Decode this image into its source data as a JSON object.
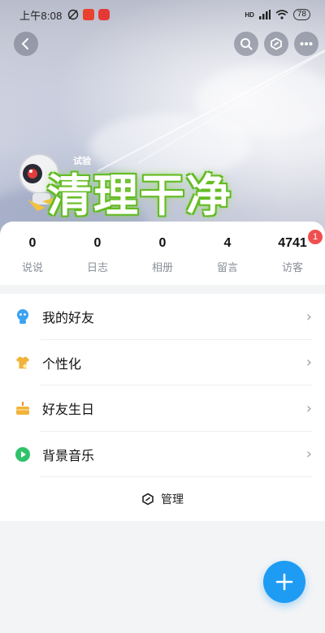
{
  "statusbar": {
    "time": "上午8:08",
    "network": "HD",
    "battery": "78"
  },
  "cover": {
    "overlay_text": "清理干净",
    "small_label": "试验"
  },
  "top_actions": [
    "back-icon",
    "search-icon",
    "hexagon-settings-icon",
    "more-icon"
  ],
  "stats": [
    {
      "value": "0",
      "label": "说说"
    },
    {
      "value": "0",
      "label": "日志"
    },
    {
      "value": "0",
      "label": "相册"
    },
    {
      "value": "4",
      "label": "留言"
    },
    {
      "value": "4741",
      "label": "访客",
      "badge": "1"
    }
  ],
  "menu": [
    {
      "label": "我的好友",
      "icon": "friends-icon"
    },
    {
      "label": "个性化",
      "icon": "shirt-icon"
    },
    {
      "label": "好友生日",
      "icon": "cake-icon"
    },
    {
      "label": "背景音乐",
      "icon": "music-icon"
    }
  ],
  "manage_label": "管理",
  "colors": {
    "accent": "#1e9cf4",
    "badge": "#f04f4f",
    "overlay_green": "#6fc22c"
  }
}
